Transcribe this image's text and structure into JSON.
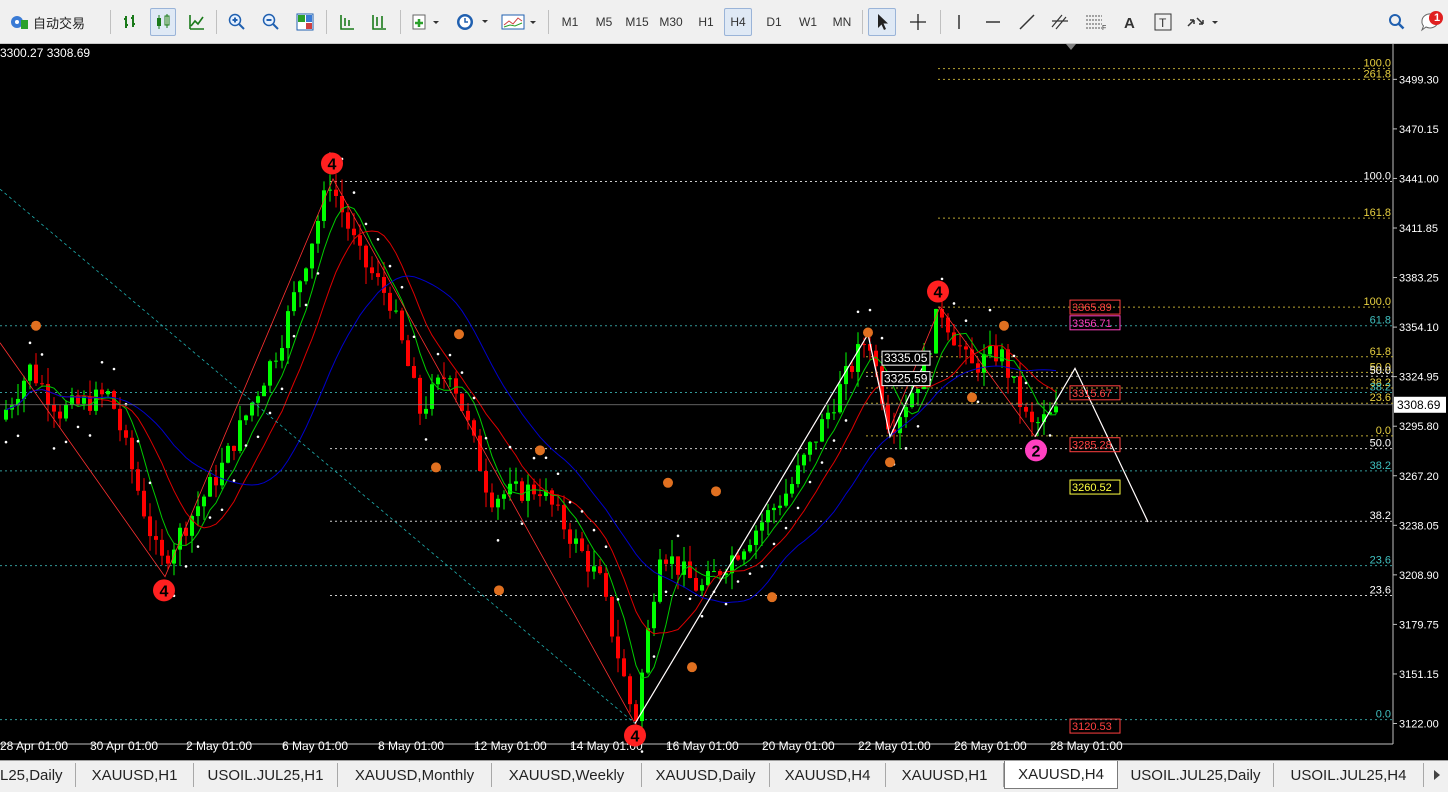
{
  "toolbar": {
    "autotrade_label": "自动交易",
    "timeframes": [
      "M1",
      "M5",
      "M15",
      "M30",
      "H1",
      "H4",
      "D1",
      "W1",
      "MN"
    ],
    "active_timeframe": "H4",
    "notification_count": "1"
  },
  "chart": {
    "info_text": "3300.27 3308.69",
    "current_price_label": "3308.69",
    "colors": {
      "background": "#000000",
      "bull": "#00ff00",
      "bear": "#ff0000",
      "ma_fast": "#00cc00",
      "ma_mid": "#dd0000",
      "ma_slow": "#0000cc",
      "psar": "#ffffff",
      "fib": "#ffffff"
    }
  },
  "chart_data": {
    "type": "candlestick",
    "symbol": "XAUUSD",
    "timeframe": "H4",
    "ylim": [
      3110,
      3520
    ],
    "y_ticks": [
      "3499.30",
      "3470.15",
      "3441.00",
      "3411.85",
      "3383.25",
      "3354.10",
      "3324.95",
      "3295.80",
      "3267.20",
      "3238.05",
      "3208.90",
      "3179.75",
      "3151.15",
      "3122.00"
    ],
    "x_ticks": [
      "28 Apr 01:00",
      "30 Apr 01:00",
      "2 May 01:00",
      "6 May 01:00",
      "8 May 01:00",
      "12 May 01:00",
      "14 May 01:00",
      "16 May 01:00",
      "20 May 01:00",
      "22 May 01:00",
      "26 May 01:00",
      "28 May 01:00"
    ],
    "fib_levels": [
      {
        "label": "100.0",
        "price": 3505.6,
        "color": "#e8d040"
      },
      {
        "label": "261.8",
        "price": 3499.3,
        "color": "#e8d040"
      },
      {
        "label": "100.0",
        "price": 3439.5,
        "color": "#ffffff"
      },
      {
        "label": "161.8",
        "price": 3418.0,
        "color": "#e8d040"
      },
      {
        "label": "100.0",
        "price": 3365.9,
        "color": "#e8d040"
      },
      {
        "label": "61.8",
        "price": 3355.0,
        "color": "#40c0c0"
      },
      {
        "label": "61.8",
        "price": 3336.8,
        "color": "#e8d040"
      },
      {
        "label": "50.0",
        "price": 3327.7,
        "color": "#e8d040"
      },
      {
        "label": "50.0",
        "price": 3325.4,
        "color": "#ffffff"
      },
      {
        "label": "38.2",
        "price": 3318.5,
        "color": "#e8d040"
      },
      {
        "label": "38.2",
        "price": 3315.9,
        "color": "#40c0c0"
      },
      {
        "label": "23.6",
        "price": 3309.6,
        "color": "#e8d040"
      },
      {
        "label": "0.0",
        "price": 3290.5,
        "color": "#e8d040"
      },
      {
        "label": "50.0",
        "price": 3283.0,
        "color": "#ffffff"
      },
      {
        "label": "38.2",
        "price": 3270.0,
        "color": "#40c0c0"
      },
      {
        "label": "38.2",
        "price": 3240.5,
        "color": "#ffffff"
      },
      {
        "label": "23.6",
        "price": 3214.5,
        "color": "#40c0c0"
      },
      {
        "label": "23.6",
        "price": 3197.0,
        "color": "#ffffff"
      },
      {
        "label": "0.0",
        "price": 3124.3,
        "color": "#40c0c0"
      }
    ],
    "price_labels": [
      {
        "text": "3365.89",
        "price": 3365.9,
        "color": "#ff4040"
      },
      {
        "text": "3356.71",
        "price": 3356.7,
        "color": "#ff40c0"
      },
      {
        "text": "3315.67",
        "price": 3315.7,
        "color": "#ff4040"
      },
      {
        "text": "3285.28",
        "price": 3285.3,
        "color": "#ff4040"
      },
      {
        "text": "3260.52",
        "price": 3260.5,
        "color": "#ffff40"
      },
      {
        "text": "3120.53",
        "price": 3120.5,
        "color": "#ff4040"
      }
    ],
    "annotations": [
      "3335.05",
      "3325.59"
    ],
    "wave_labels": [
      "4",
      "4",
      "4",
      "4",
      "2"
    ]
  },
  "tabs": [
    "L25,Daily",
    "XAUUSD,H1",
    "USOIL.JUL25,H1",
    "XAUUSD,Monthly",
    "XAUUSD,Weekly",
    "XAUUSD,Daily",
    "XAUUSD,H4",
    "XAUUSD,H1",
    "XAUUSD,H4",
    "USOIL.JUL25,Daily",
    "USOIL.JUL25,H4"
  ],
  "active_tab_index": 8
}
